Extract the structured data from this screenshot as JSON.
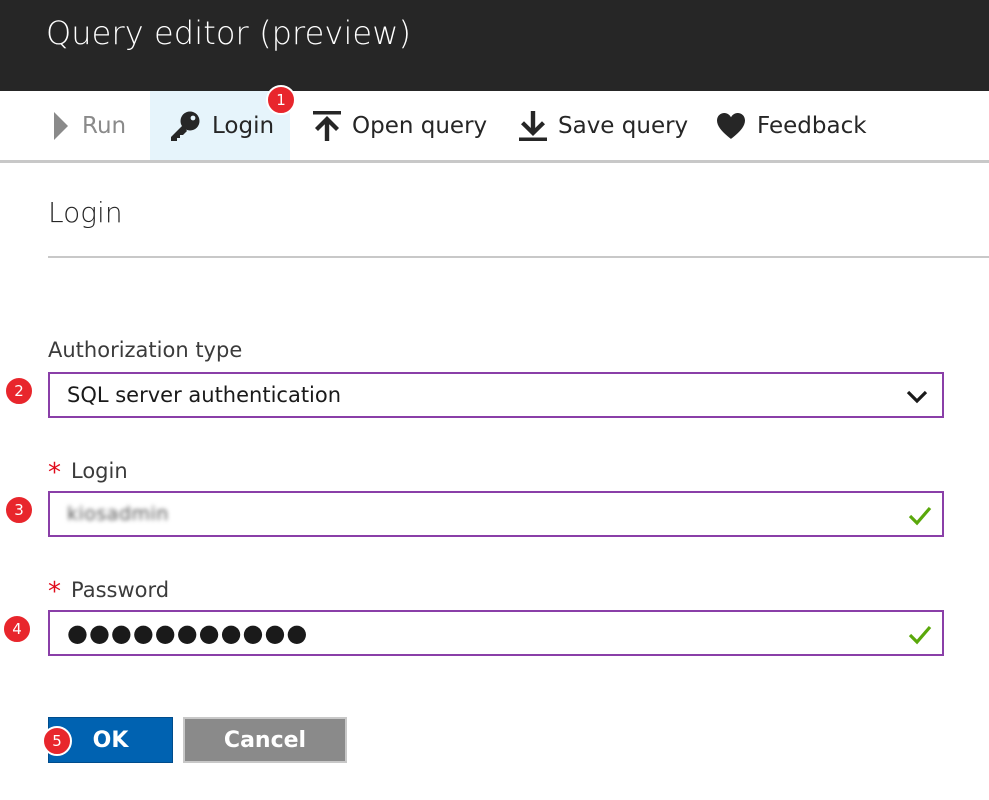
{
  "window": {
    "title": "Query editor (preview)"
  },
  "toolbar": {
    "run_label": "Run",
    "login_label": "Login",
    "open_label": "Open query",
    "save_label": "Save query",
    "feedback_label": "Feedback"
  },
  "badges": [
    "1",
    "2",
    "3",
    "4",
    "5"
  ],
  "blade": {
    "title": "Login"
  },
  "form": {
    "auth_type_label": "Authorization type",
    "auth_type_value": "SQL server authentication",
    "required_marker": "*",
    "login_label": "Login",
    "login_value": "kiosadmin",
    "password_label": "Password",
    "password_value": "●●●●●●●●●●●"
  },
  "buttons": {
    "ok_label": "OK",
    "cancel_label": "Cancel"
  },
  "colors": {
    "titlebar": "#262626",
    "active_tab": "#e6f4fb",
    "field_border": "#8a3fa8",
    "valid_check": "#5aa80b",
    "badge": "#e8262c",
    "ok_button": "#0062b1",
    "cancel_button": "#8a8a8a"
  },
  "icons": [
    "play-icon",
    "key-icon",
    "upload-icon",
    "download-icon",
    "heart-icon",
    "chevron-down-icon",
    "check-icon"
  ]
}
